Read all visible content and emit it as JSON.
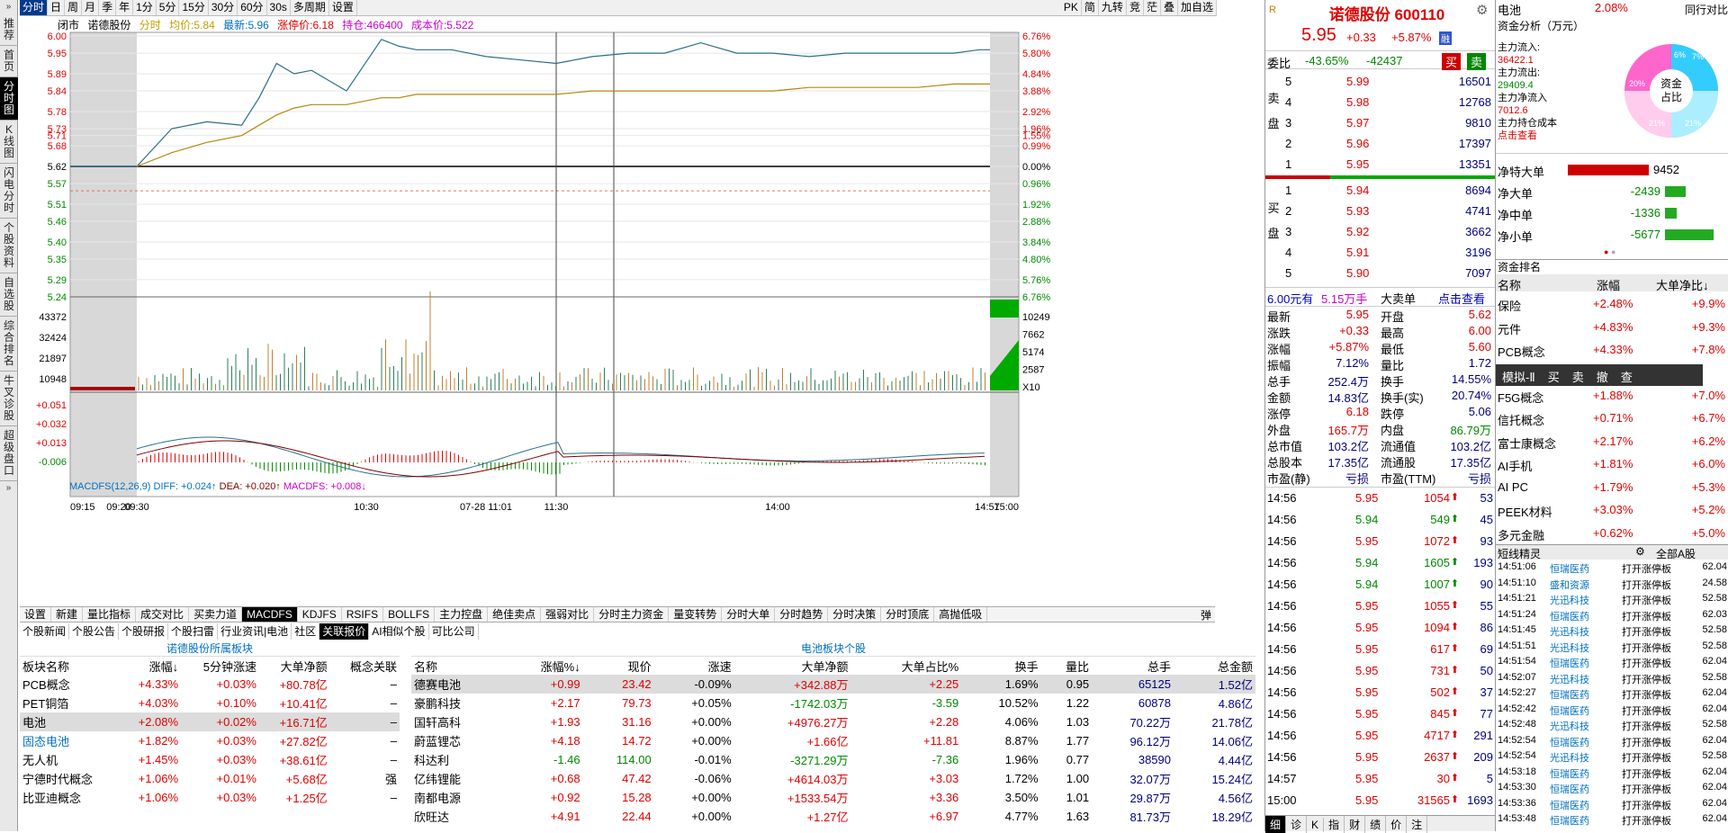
{
  "sidebar": {
    "top_arrow": "»",
    "bottom_arrow": "»",
    "tabs": [
      "推荐",
      "首页",
      "分时图",
      "K线图",
      "闪电分时",
      "个股资料",
      "自选股",
      "综合排名",
      "牛叉诊股",
      "超级盘口"
    ],
    "active": 2
  },
  "toolbar": {
    "left": [
      "分时",
      "日",
      "周",
      "月",
      "季",
      "年",
      "1分",
      "5分",
      "15分",
      "30分",
      "60分",
      "30s",
      "多周期",
      "设置"
    ],
    "right": [
      "PK",
      "简",
      "九转",
      "竞",
      "茫",
      "叠",
      "加自选"
    ],
    "active": 0
  },
  "chart_info": {
    "status": "闭市",
    "name": "诺德股份",
    "mode": "分时",
    "avg": "均价:5.84",
    "latest": "最新:5.96",
    "limit": "涨停价:6.18",
    "position": "持仓:466400",
    "cost": "成本价:5.522"
  },
  "macd_label": {
    "name": "MACDFS(12,26,9)",
    "diff": "DIFF: +0.024↑",
    "dea": "DEA: +0.020↑",
    "macd": "MACDFS: +0.008↓"
  },
  "chart_data": [
    {
      "type": "line",
      "name": "intraday-price",
      "y_left_ticks": [
        "6.00",
        "5.95",
        "5.89",
        "5.84",
        "5.78",
        "5.73",
        "5.71",
        "5.68",
        "5.62",
        "5.57",
        "5.51",
        "5.46",
        "5.40",
        "5.35",
        "5.29",
        "5.24"
      ],
      "y_right_ticks": [
        "6.76%",
        "5.80%",
        "4.84%",
        "3.88%",
        "2.92%",
        "1.96%",
        "1.55%",
        "0.99%",
        "0.00%",
        "0.96%",
        "1.92%",
        "2.88%",
        "3.84%",
        "4.80%",
        "5.76%",
        "6.76%"
      ],
      "ylim": [
        5.24,
        6.0
      ],
      "pre_close": 5.62,
      "x_ticks": [
        "09:15",
        "09:20",
        "09:30",
        "10:30",
        "07-28 11:01",
        "11:30",
        "14:00",
        "14:57",
        "15:00"
      ],
      "x": [
        "09:15",
        "09:25",
        "09:30",
        "09:40",
        "09:50",
        "10:00",
        "10:05",
        "10:10",
        "10:15",
        "10:20",
        "10:30",
        "10:40",
        "10:45",
        "10:50",
        "11:00",
        "11:10",
        "11:20",
        "11:30",
        "13:10",
        "13:20",
        "13:30",
        "13:40",
        "13:50",
        "14:00",
        "14:10",
        "14:20",
        "14:30",
        "14:40",
        "14:50",
        "14:57",
        "15:00"
      ],
      "series": [
        {
          "values": [
            5.62,
            5.62,
            5.62,
            5.73,
            5.75,
            5.74,
            5.82,
            5.92,
            5.89,
            5.9,
            5.84,
            5.99,
            5.97,
            5.96,
            5.96,
            5.94,
            5.93,
            5.92,
            5.94,
            5.95,
            5.95,
            5.98,
            5.95,
            5.95,
            5.94,
            5.95,
            5.95,
            5.95,
            5.95,
            5.96,
            5.96
          ]
        },
        {
          "values": [
            null,
            null,
            5.62,
            5.66,
            5.69,
            5.71,
            5.74,
            5.77,
            5.79,
            5.8,
            5.8,
            5.82,
            5.82,
            5.83,
            5.83,
            5.83,
            5.83,
            5.83,
            5.84,
            5.84,
            5.84,
            5.84,
            5.84,
            5.84,
            5.85,
            5.85,
            5.85,
            5.85,
            5.86,
            5.86,
            5.86
          ]
        }
      ]
    },
    {
      "type": "bar",
      "name": "volume",
      "y_left_ticks": [
        "43372",
        "32424",
        "21897",
        "10948"
      ],
      "y_right_ticks": [
        "10249",
        "7662",
        "5174",
        "2587",
        "X10"
      ]
    },
    {
      "type": "line",
      "name": "macd",
      "y_left_ticks": [
        "+0.051",
        "+0.032",
        "+0.013",
        "-0.006"
      ]
    }
  ],
  "lower_tabs": {
    "items": [
      "设置",
      "新建",
      "量比指标",
      "成交对比",
      "买卖力道",
      "MACDFS",
      "KDJFS",
      "RSIFS",
      "BOLLFS",
      "主力控盘",
      "绝佳卖点",
      "强弱对比",
      "分时主力资金",
      "量变转势",
      "分时大单",
      "分时趋势",
      "分时决策",
      "分时顶底",
      "高抛低吸"
    ],
    "active": 5,
    "toggle": "弹"
  },
  "sub_tabs": {
    "items": [
      "个股新闻",
      "个股公告",
      "个股研报",
      "个股扫雷",
      "行业资讯|电池",
      "社区",
      "关联报价",
      "AI相似个股",
      "可比公司"
    ],
    "active": 6
  },
  "sector_table": {
    "title": "诺德股份所属板块",
    "headers": [
      "板块名称",
      "涨幅↓",
      "5分钟涨速",
      "大单净额",
      "概念关联"
    ],
    "rows": [
      [
        "PCB概念",
        "+4.33%",
        "+0.03%",
        "+80.78亿",
        "–"
      ],
      [
        "PET铜箔",
        "+4.03%",
        "+0.10%",
        "+10.41亿",
        "–"
      ],
      [
        "电池",
        "+2.08%",
        "+0.02%",
        "+16.71亿",
        "–"
      ],
      [
        "固态电池",
        "+1.82%",
        "+0.03%",
        "+27.82亿",
        "–"
      ],
      [
        "无人机",
        "+1.45%",
        "+0.03%",
        "+38.61亿",
        "–"
      ],
      [
        "宁德时代概念",
        "+1.06%",
        "+0.01%",
        "+5.68亿",
        "强"
      ],
      [
        "比亚迪概念",
        "+1.06%",
        "+0.03%",
        "+1.25亿",
        "–"
      ]
    ]
  },
  "stock_table": {
    "title": "电池板块个股",
    "headers": [
      "名称",
      "涨幅%↓",
      "现价",
      "涨速",
      "大单净额",
      "大单占比%",
      "换手",
      "量比",
      "总手",
      "总金额"
    ],
    "rows": [
      [
        "德赛电池",
        "+0.99",
        "23.42",
        "-0.09%",
        "+342.88万",
        "+2.25",
        "1.69%",
        "0.95",
        "65125",
        "1.52亿"
      ],
      [
        "豪鹏科技",
        "+2.17",
        "79.73",
        "+0.05%",
        "-1742.03万",
        "-3.59",
        "10.52%",
        "1.22",
        "60878",
        "4.86亿"
      ],
      [
        "国轩高科",
        "+1.93",
        "31.16",
        "+0.00%",
        "+4976.27万",
        "+2.28",
        "4.06%",
        "1.03",
        "70.22万",
        "21.78亿"
      ],
      [
        "蔚蓝锂芯",
        "+4.18",
        "14.72",
        "+0.00%",
        "+1.66亿",
        "+11.81",
        "8.87%",
        "1.77",
        "96.12万",
        "14.06亿"
      ],
      [
        "科达利",
        "-1.46",
        "114.00",
        "-0.01%",
        "-3271.29万",
        "-7.36",
        "1.96%",
        "0.77",
        "38590",
        "4.44亿"
      ],
      [
        "亿纬锂能",
        "+0.68",
        "47.42",
        "-0.06%",
        "+4614.03万",
        "+3.03",
        "1.72%",
        "1.00",
        "32.07万",
        "15.24亿"
      ],
      [
        "南都电源",
        "+0.92",
        "15.28",
        "+0.00%",
        "+1533.54万",
        "+3.36",
        "3.50%",
        "1.01",
        "29.87万",
        "4.56亿"
      ],
      [
        "欣旺达",
        "+4.91",
        "22.44",
        "+0.00%",
        "+1.27亿",
        "+6.97",
        "4.77%",
        "1.63",
        "81.73万",
        "18.29亿"
      ]
    ]
  },
  "quote": {
    "badge": "R",
    "title": "诺德股份 600110",
    "price": "5.95",
    "change": "+0.33",
    "pct": "+5.87%",
    "flag": "融",
    "wei": "委比",
    "wei_pct": "-43.65%",
    "wei_val": "-42437",
    "buy_btn": "买",
    "sell_btn": "卖",
    "sell_label": "卖盘",
    "buy_label": "买盘",
    "asks": [
      [
        "5",
        "5.99",
        "16501"
      ],
      [
        "4",
        "5.98",
        "12768"
      ],
      [
        "3",
        "5.97",
        "9810"
      ],
      [
        "2",
        "5.96",
        "17397"
      ],
      [
        "1",
        "5.95",
        "13351"
      ]
    ],
    "bids": [
      [
        "1",
        "5.94",
        "8694"
      ],
      [
        "2",
        "5.93",
        "4741"
      ],
      [
        "3",
        "5.92",
        "3662"
      ],
      [
        "4",
        "5.91",
        "3196"
      ],
      [
        "5",
        "5.90",
        "7097"
      ]
    ],
    "bigline": {
      "a": "6.00元有",
      "b": "5.15万手",
      "c": "大卖单",
      "d": "点击查看"
    },
    "stats": [
      [
        "最新",
        "5.95",
        "开盘",
        "5.62"
      ],
      [
        "涨跌",
        "+0.33",
        "最高",
        "6.00"
      ],
      [
        "涨幅",
        "+5.87%",
        "最低",
        "5.60"
      ],
      [
        "振幅",
        "7.12%",
        "量比",
        "1.72"
      ],
      [
        "总手",
        "252.4万",
        "换手",
        "14.55%"
      ],
      [
        "金额",
        "14.83亿",
        "换手(实)",
        "20.74%"
      ],
      [
        "涨停",
        "6.18",
        "跌停",
        "5.06"
      ],
      [
        "外盘",
        "165.7万",
        "内盘",
        "86.79万"
      ],
      [
        "总市值",
        "103.2亿",
        "流通值",
        "103.2亿"
      ],
      [
        "总股本",
        "17.35亿",
        "流通股",
        "17.35亿"
      ],
      [
        "市盈(静)",
        "亏损",
        "市盈(TTM)",
        "亏损"
      ]
    ],
    "ticks": [
      [
        "14:56",
        "5.95",
        "1054",
        "53"
      ],
      [
        "14:56",
        "5.94",
        "549",
        "45"
      ],
      [
        "14:56",
        "5.95",
        "1072",
        "93"
      ],
      [
        "14:56",
        "5.94",
        "1605",
        "193"
      ],
      [
        "14:56",
        "5.94",
        "1007",
        "90"
      ],
      [
        "14:56",
        "5.95",
        "1055",
        "55"
      ],
      [
        "14:56",
        "5.95",
        "1094",
        "86"
      ],
      [
        "14:56",
        "5.95",
        "617",
        "69"
      ],
      [
        "14:56",
        "5.95",
        "731",
        "50"
      ],
      [
        "14:56",
        "5.95",
        "502",
        "37"
      ],
      [
        "14:56",
        "5.95",
        "845",
        "77"
      ],
      [
        "14:56",
        "5.95",
        "4717",
        "291"
      ],
      [
        "14:56",
        "5.95",
        "2637",
        "209"
      ],
      [
        "14:57",
        "5.95",
        "30",
        "5"
      ],
      [
        "15:00",
        "5.95",
        "31565",
        "1693"
      ]
    ],
    "bottom_tabs": [
      "细",
      "诊",
      "K",
      "指",
      "财",
      "绩",
      "价",
      "注"
    ]
  },
  "right": {
    "name": "电池",
    "pct": "2.08%",
    "peer": "同行对比",
    "fund_title": "资金分析（万元）",
    "fund_lines": [
      "主力流入:",
      "36422.1",
      "主力流出:",
      "29409.4",
      "主力净流入",
      "7012.6",
      "主力持仓成本",
      "点击查看"
    ],
    "donut_center": "资金占比",
    "donut_pcts": [
      "6%",
      "7%",
      "20%",
      "21%",
      "21%"
    ],
    "net": [
      [
        "净特大单",
        "9452"
      ],
      [
        "净大单",
        "-2439"
      ],
      [
        "净中单",
        "-1336"
      ],
      [
        "净小单",
        "-5677"
      ]
    ],
    "rank_title": "资金排名",
    "rank_headers": [
      "名称",
      "涨幅",
      "大单净比↓"
    ],
    "rank": [
      [
        "保险",
        "+2.48%",
        "+9.9%"
      ],
      [
        "元件",
        "+4.83%",
        "+9.3%"
      ],
      [
        "PCB概念",
        "+4.33%",
        "+7.8%"
      ],
      [
        "F5G概念",
        "+1.88%",
        "+7.0%"
      ],
      [
        "信托概念",
        "+0.71%",
        "+6.7%"
      ],
      [
        "富士康概念",
        "+2.17%",
        "+6.2%"
      ],
      [
        "AI手机",
        "+1.81%",
        "+6.0%"
      ],
      [
        "AI PC",
        "+1.79%",
        "+5.3%"
      ],
      [
        "PEEK材料",
        "+3.03%",
        "+5.2%"
      ],
      [
        "多元金融",
        "+0.62%",
        "+5.0%"
      ]
    ],
    "sim_bar": [
      "模拟-Ⅱ",
      "买",
      "卖",
      "撤",
      "查"
    ],
    "dx_title": "短线精灵",
    "dx_filter": "全部A股",
    "dx": [
      [
        "14:51:06",
        "恒瑞医药",
        "打开涨停板",
        "62.04"
      ],
      [
        "14:51:10",
        "盛和资源",
        "打开涨停板",
        "24.58"
      ],
      [
        "14:51:21",
        "光迅科技",
        "打开涨停板",
        "52.58"
      ],
      [
        "14:51:24",
        "恒瑞医药",
        "打开涨停板",
        "62.03"
      ],
      [
        "14:51:45",
        "光迅科技",
        "打开涨停板",
        "52.58"
      ],
      [
        "14:51:51",
        "光迅科技",
        "打开涨停板",
        "52.58"
      ],
      [
        "14:51:54",
        "恒瑞医药",
        "打开涨停板",
        "62.04"
      ],
      [
        "14:52:07",
        "光迅科技",
        "打开涨停板",
        "52.58"
      ],
      [
        "14:52:27",
        "恒瑞医药",
        "打开涨停板",
        "62.04"
      ],
      [
        "14:52:42",
        "恒瑞医药",
        "打开涨停板",
        "62.04"
      ],
      [
        "14:52:48",
        "光迅科技",
        "打开涨停板",
        "52.58"
      ],
      [
        "14:52:54",
        "恒瑞医药",
        "打开涨停板",
        "62.04"
      ],
      [
        "14:52:54",
        "光迅科技",
        "打开涨停板",
        "52.58"
      ],
      [
        "14:53:18",
        "恒瑞医药",
        "打开涨停板",
        "62.04"
      ],
      [
        "14:53:30",
        "恒瑞医药",
        "打开涨停板",
        "62.04"
      ],
      [
        "14:53:36",
        "恒瑞医药",
        "打开涨停板",
        "62.04"
      ],
      [
        "14:53:48",
        "恒瑞医药",
        "打开涨停板",
        "62.04"
      ]
    ]
  }
}
